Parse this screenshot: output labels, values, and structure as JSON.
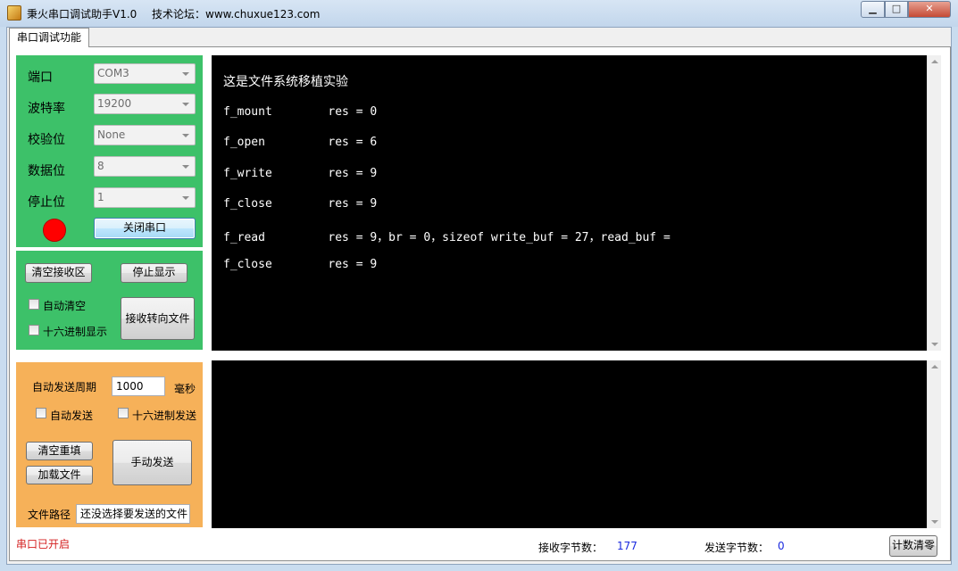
{
  "window": {
    "title": "秉火串口调试助手V1.0",
    "forum": "技术论坛：www.chuxue123.com",
    "minimize": "▁",
    "maximize": "□",
    "close": "✕"
  },
  "tab": {
    "label": "串口调试功能"
  },
  "port_settings": {
    "port_label": "端口",
    "port_value": "COM3",
    "baud_label": "波特率",
    "baud_value": "19200",
    "parity_label": "校验位",
    "parity_value": "None",
    "databits_label": "数据位",
    "databits_value": "8",
    "stopbits_label": "停止位",
    "stopbits_value": "1",
    "close_port_button": "关闭串口",
    "led_color": "#ff0000"
  },
  "receive_controls": {
    "clear_button": "清空接收区",
    "stop_display_button": "停止显示",
    "auto_clear_label": "自动清空",
    "hex_display_label": "十六进制显示",
    "redirect_file_button": "接收转向文件"
  },
  "receive_area": {
    "title": "这是文件系统移植实验",
    "lines": [
      "f_mount        res = 0",
      "f_open         res = 6",
      "f_write        res = 9",
      "f_close        res = 9",
      "f_read         res = 9，br = 0，sizeof write_buf = 27，read_buf =",
      "f_close        res = 9"
    ]
  },
  "send_controls": {
    "period_label": "自动发送周期",
    "period_value": "1000",
    "period_unit": "毫秒",
    "auto_send_label": "自动发送",
    "hex_send_label": "十六进制发送",
    "clear_refill_button": "清空重填",
    "load_file_button": "加载文件",
    "manual_send_button": "手动发送",
    "file_path_label": "文件路径",
    "file_path_value": "还没选择要发送的文件"
  },
  "status": {
    "port_status": "串口已开启",
    "rx_label": "接收字节数：",
    "rx_count": "177",
    "tx_label": "发送字节数：",
    "tx_count": "0",
    "reset_count_button": "计数清零"
  },
  "colors": {
    "port_panel": "#3dc169",
    "send_panel": "#f6b159",
    "terminal_bg": "#000000",
    "status_text": "#d42020",
    "count_value": "#1a2adf"
  }
}
